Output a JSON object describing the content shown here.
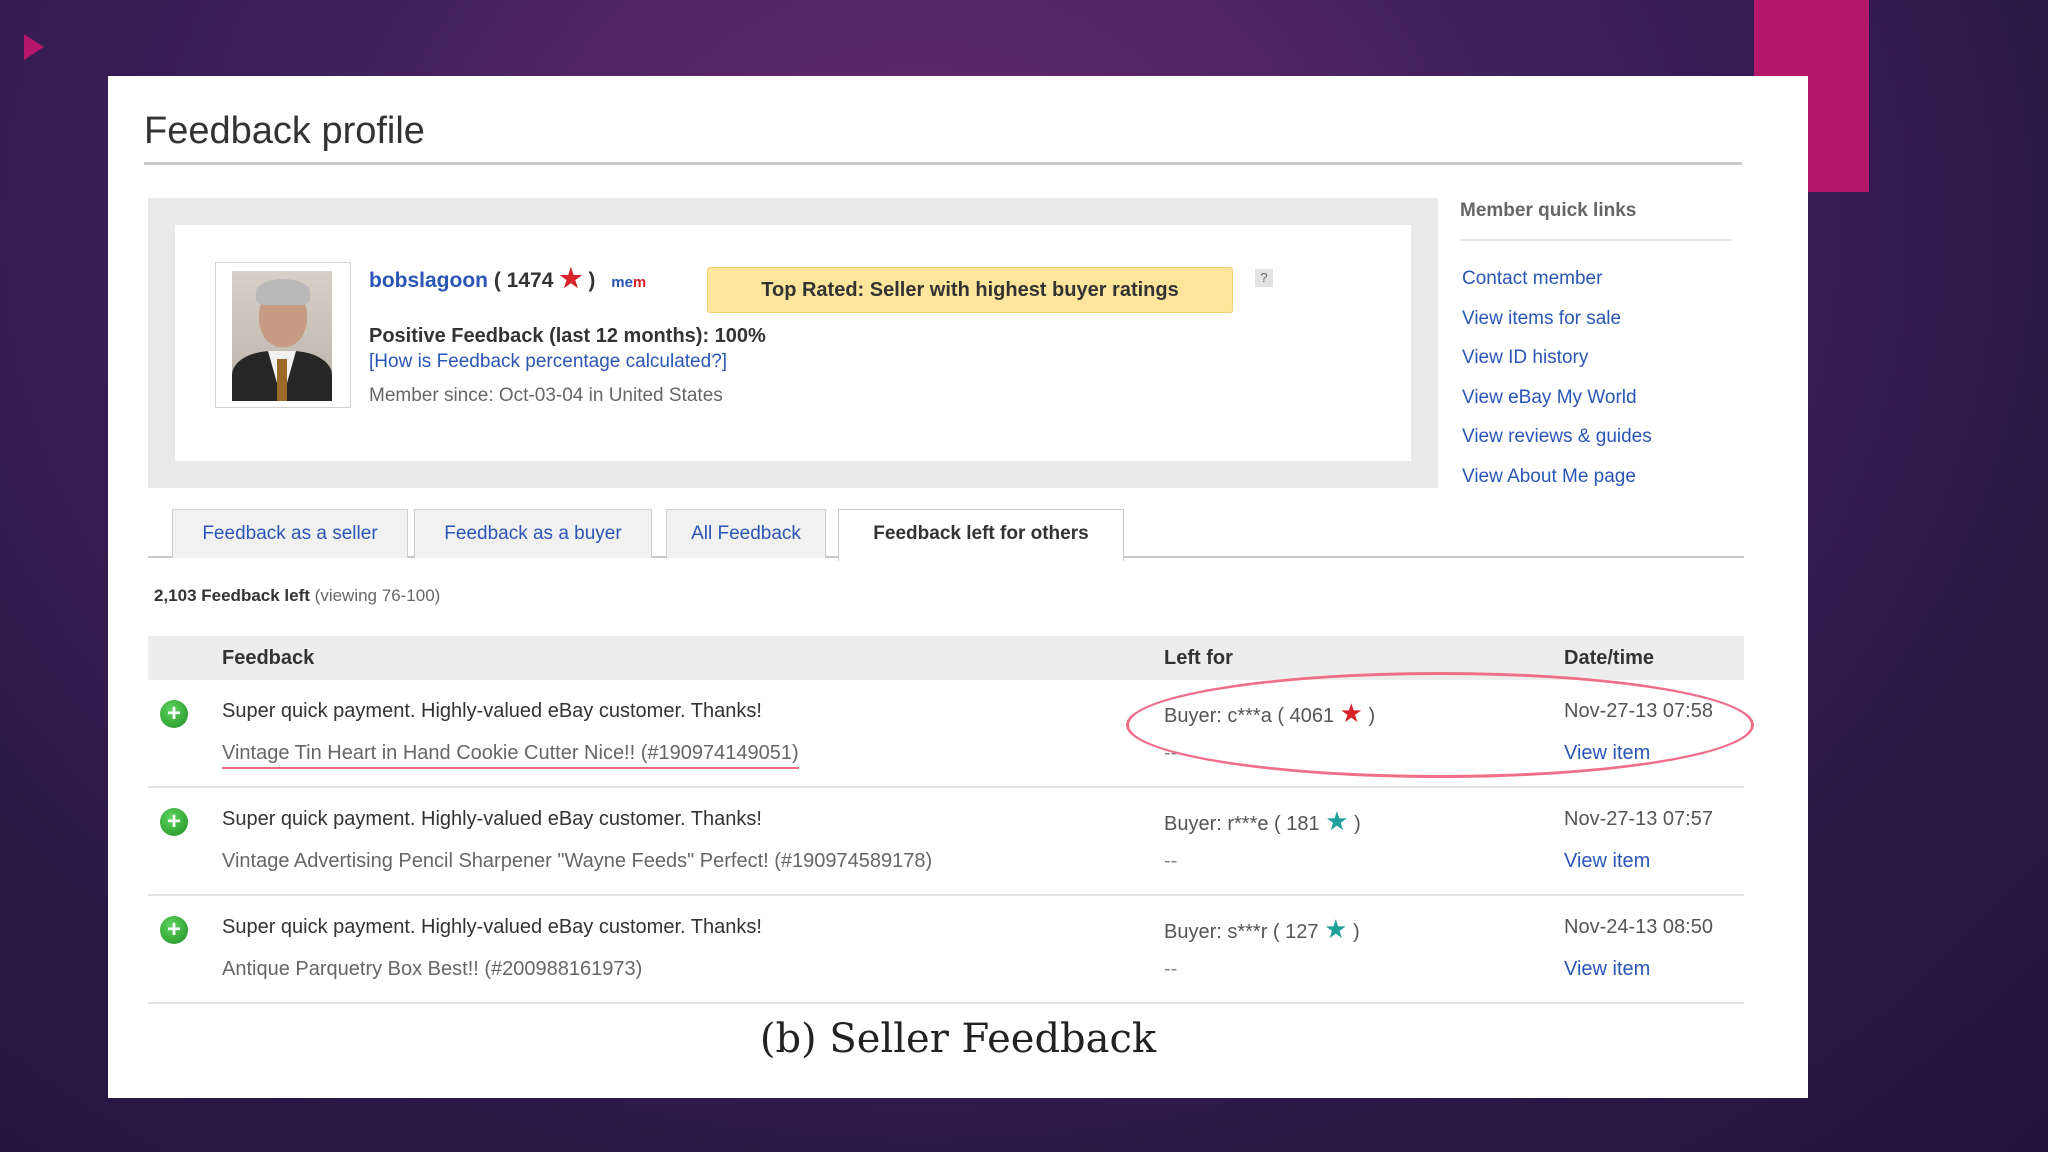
{
  "page": {
    "title": "Feedback profile",
    "caption": "(b) Seller Feedback"
  },
  "profile": {
    "username": "bobslagoon",
    "score_open": "( 1474",
    "score_close": ")",
    "me_badge_left": "me",
    "me_badge_right": "m",
    "top_rated": "Top Rated: Seller with highest buyer ratings",
    "help_icon": "?",
    "positive_feedback": "Positive Feedback (last 12 months): 100%",
    "calc_link": "[How is Feedback percentage calculated?]",
    "member_since": "Member since: Oct-03-04 in United States"
  },
  "quick_links": {
    "title": "Member quick links",
    "items": [
      "Contact member",
      "View items for sale",
      "View ID history",
      "View eBay My World",
      "View reviews & guides",
      "View About Me page"
    ]
  },
  "tabs": [
    {
      "label": "Feedback as a seller",
      "active": false
    },
    {
      "label": "Feedback as a buyer",
      "active": false
    },
    {
      "label": "All Feedback",
      "active": false
    },
    {
      "label": "Feedback left for others",
      "active": true
    }
  ],
  "summary": {
    "count": "2,103 Feedback left",
    "viewing": "(viewing 76-100)"
  },
  "table": {
    "headers": {
      "feedback": "Feedback",
      "left_for": "Left for",
      "date": "Date/time"
    },
    "rows": [
      {
        "comment": "Super quick payment. Highly-valued eBay customer. Thanks!",
        "item": "Vintage Tin Heart in Hand Cookie Cutter Nice!! (#190974149051)",
        "buyer_prefix": "Buyer: c***a ( 4061",
        "buyer_suffix": ")",
        "star_color": "#d8232a",
        "dash": "--",
        "date": "Nov-27-13 07:58",
        "view_item": "View item"
      },
      {
        "comment": "Super quick payment. Highly-valued eBay customer. Thanks!",
        "item": "Vintage Advertising Pencil Sharpener \"Wayne Feeds\" Perfect! (#190974589178)",
        "buyer_prefix": "Buyer: r***e ( 181",
        "buyer_suffix": ")",
        "star_color": "#20a09a",
        "dash": "--",
        "date": "Nov-27-13 07:57",
        "view_item": "View item"
      },
      {
        "comment": "Super quick payment. Highly-valued eBay customer. Thanks!",
        "item": "Antique Parquetry Box Best!! (#200988161973)",
        "buyer_prefix": "Buyer: s***r ( 127",
        "buyer_suffix": ")",
        "star_color": "#20a09a",
        "dash": "--",
        "date": "Nov-24-13 08:50",
        "view_item": "View item"
      }
    ]
  },
  "colors": {
    "link_blue": "#2a56b5",
    "accent_pink": "#b5176b",
    "highlight_oval": "#ef6f8a",
    "top_rated_bg": "#fde69b"
  }
}
